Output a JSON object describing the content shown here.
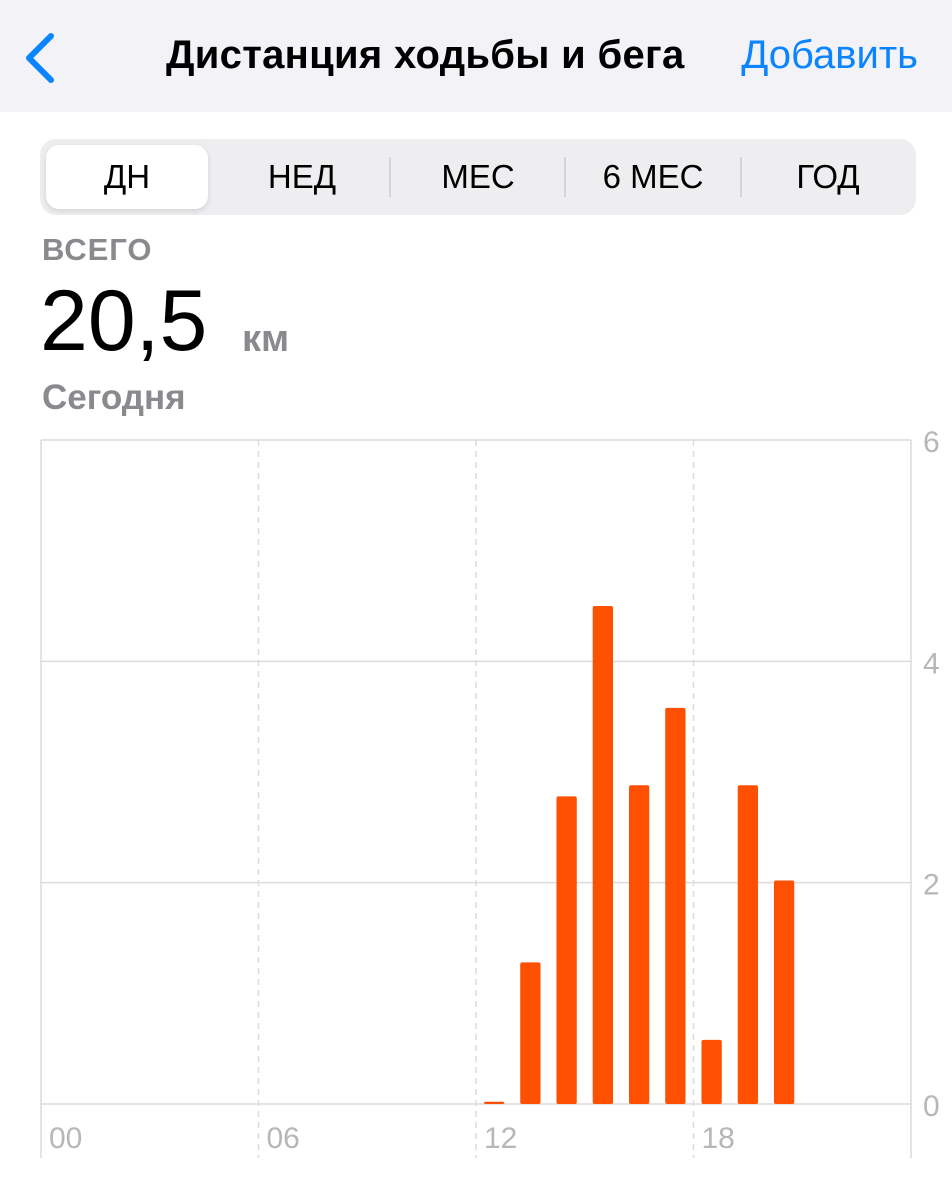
{
  "nav": {
    "back_icon": "chevron-left-icon",
    "title": "Дистанция ходьбы и бега",
    "add_label": "Добавить"
  },
  "segments": [
    {
      "label": "ДН",
      "active": true
    },
    {
      "label": "НЕД",
      "active": false
    },
    {
      "label": "МЕС",
      "active": false
    },
    {
      "label": "6 МЕС",
      "active": false
    },
    {
      "label": "ГОД",
      "active": false
    }
  ],
  "summary": {
    "total_label": "ВСЕГО",
    "value": "20,5",
    "unit": "км",
    "date": "Сегодня"
  },
  "colors": {
    "accent": "#0a84ff",
    "bar": "#ff4f00",
    "grid": "#dcdcdc",
    "axis_text": "#b7b7b7",
    "nav_bg": "#f2f2f7"
  },
  "chart_data": {
    "type": "bar",
    "x_tick_labels": [
      "00",
      "06",
      "12",
      "18"
    ],
    "y_tick_labels": [
      "0",
      "2",
      "4",
      "6"
    ],
    "ylim": [
      0,
      6
    ],
    "xlim": [
      0,
      24
    ],
    "grid": true,
    "y_axis_side": "right",
    "hours": [
      12,
      13,
      14,
      15,
      16,
      17,
      18,
      19,
      20
    ],
    "values": [
      0.02,
      1.28,
      2.78,
      4.5,
      2.88,
      3.58,
      0.58,
      2.88,
      2.02
    ]
  }
}
